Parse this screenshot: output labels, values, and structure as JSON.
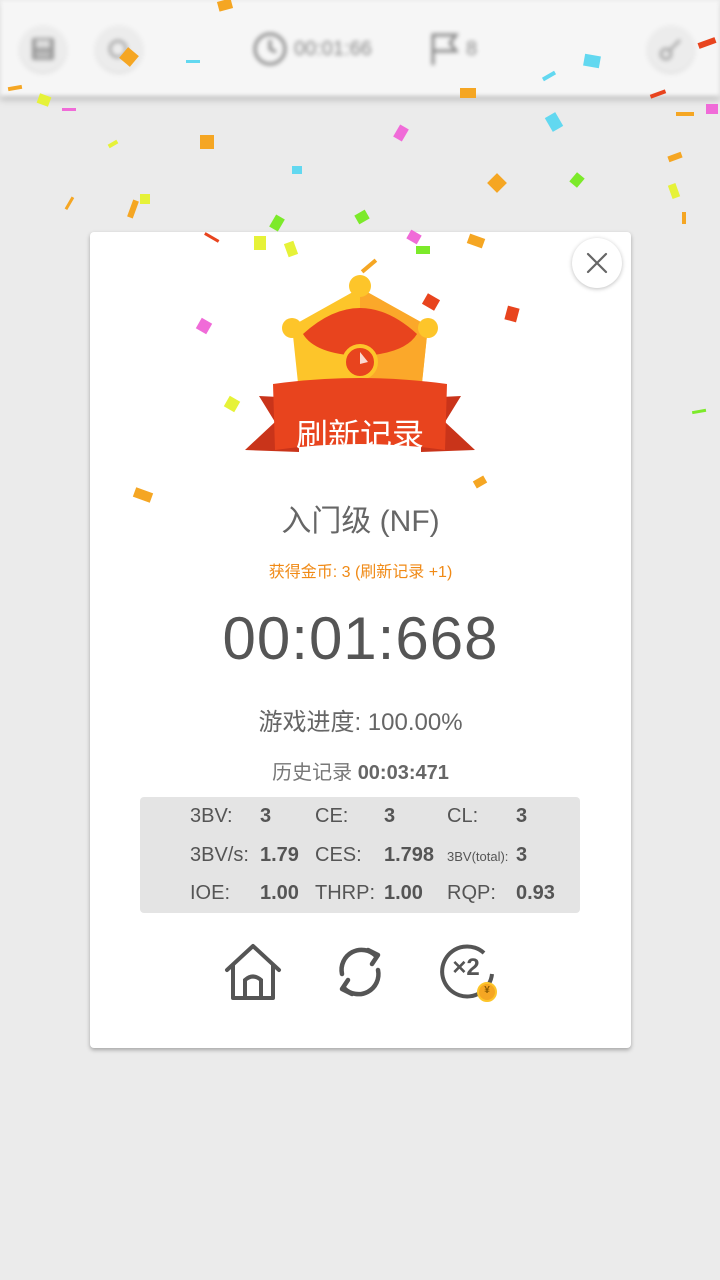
{
  "toolbar": {
    "timer_text": "00:01:66",
    "flag_count": "8"
  },
  "dialog": {
    "banner_text": "刷新记录",
    "level": "入门级 (NF)",
    "coins": "获得金币: 3 (刷新记录 +1)",
    "time": "00:01:668",
    "progress_label": "游戏进度:",
    "progress_value": "100.00%",
    "history_label": "历史记录",
    "history_value": "00:03:471",
    "stats": {
      "bbbv_label": "3BV:",
      "bbbv": "3",
      "ce_label": "CE:",
      "ce": "3",
      "cl_label": "CL:",
      "cl": "3",
      "bbbvs_label": "3BV/s:",
      "bbbvs": "1.79",
      "ces_label": "CES:",
      "ces": "1.798",
      "bbbv_total_label": "3BV(total):",
      "bbbv_total": "3",
      "ioe_label": "IOE:",
      "ioe": "1.00",
      "thrp_label": "THRP:",
      "thrp": "1.00",
      "rqp_label": "RQP:",
      "rqp": "0.93"
    },
    "double_badge": "×2",
    "coin_symbol": "¥"
  },
  "colors": {
    "accent_orange": "#f08a16",
    "ribbon_red": "#e8441e",
    "crown_yellow": "#fdc52a",
    "background": "#ebebeb"
  }
}
